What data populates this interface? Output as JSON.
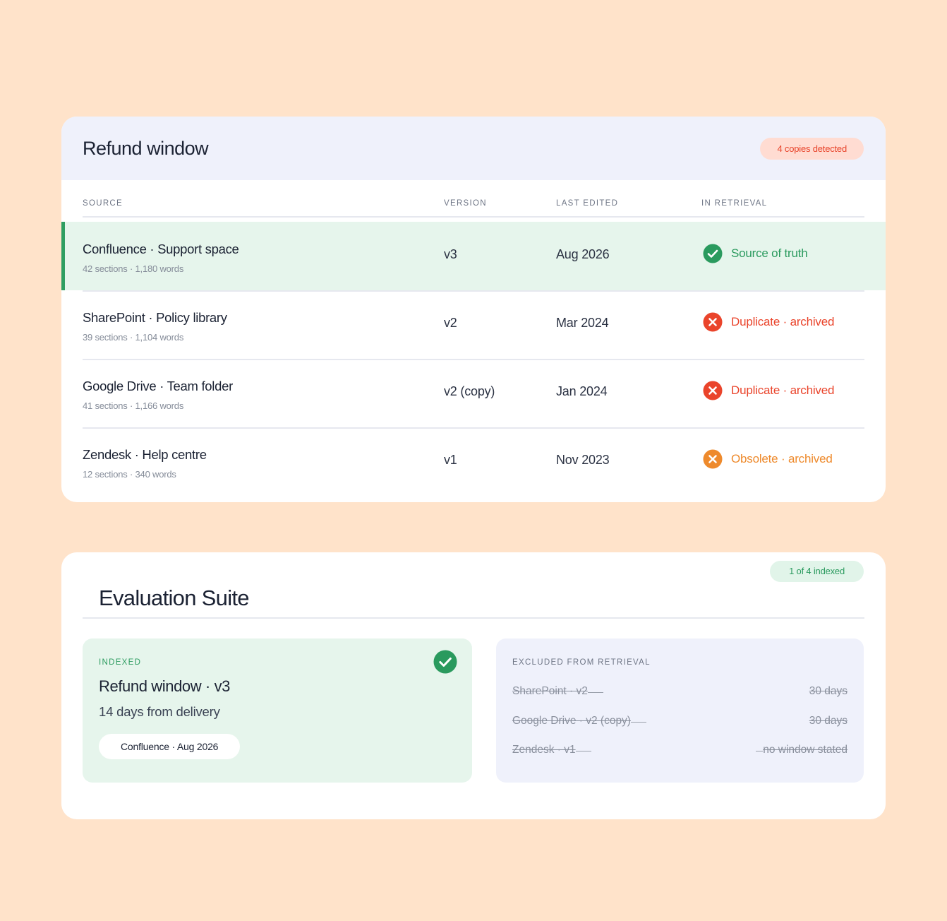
{
  "top_card": {
    "title": "Refund window",
    "badge": "4 copies detected",
    "columns": [
      "SOURCE",
      "VERSION",
      "LAST EDITED",
      "IN RETRIEVAL"
    ],
    "rows": [
      {
        "source": "Confluence · Support space",
        "meta": "42 sections · 1,180 words",
        "version": "v3",
        "last_edited": "Aug 2026",
        "status": "Source of truth",
        "status_icon": "check-circle-icon",
        "status_color": "#2a9a5e",
        "active": true
      },
      {
        "source": "SharePoint · Policy library",
        "meta": "39 sections · 1,104 words",
        "version": "v2",
        "last_edited": "Mar 2024",
        "status": "Duplicate · archived",
        "status_icon": "x-circle-icon",
        "status_color": "#ea442b",
        "active": false
      },
      {
        "source": "Google Drive · Team folder",
        "meta": "41 sections · 1,166 words",
        "version": "v2 (copy)",
        "last_edited": "Jan 2024",
        "status": "Duplicate · archived",
        "status_icon": "x-circle-icon",
        "status_color": "#ea442b",
        "active": false
      },
      {
        "source": "Zendesk · Help centre",
        "meta": "12 sections · 340 words",
        "version": "v1",
        "last_edited": "Nov 2023",
        "status": "Obsolete · archived",
        "status_icon": "x-circle-icon",
        "status_color": "#ee8a2c",
        "active": false
      }
    ]
  },
  "bottom_card": {
    "title": "Evaluation Suite",
    "badge": "1 of 4 indexed",
    "indexed": {
      "label": "INDEXED",
      "title": "Refund window · v3",
      "subtitle": "14 days from delivery",
      "chip": "Confluence · Aug 2026",
      "icon": "check-circle-icon"
    },
    "excluded": {
      "label": "EXCLUDED FROM RETRIEVAL",
      "items": [
        {
          "name": "SharePoint · v2",
          "value": "30 days"
        },
        {
          "name": "Google Drive · v2 (copy)",
          "value": "30 days"
        },
        {
          "name": "Zendesk · v1",
          "value": "no window stated"
        }
      ]
    }
  },
  "colors": {
    "background": "#ffe3ca",
    "accent_green": "#2a9a5e",
    "accent_red": "#ea442b",
    "accent_orange": "#ee8a2c"
  }
}
